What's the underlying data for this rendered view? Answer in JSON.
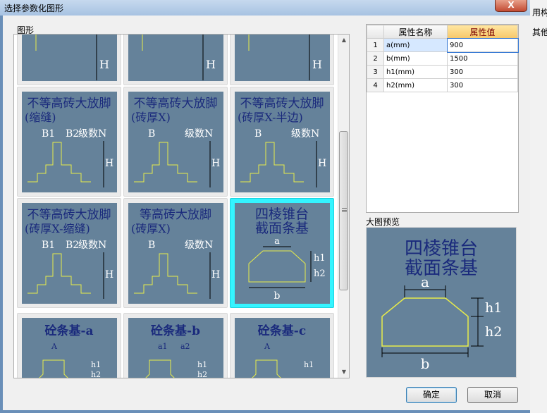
{
  "window": {
    "title": "选择参数化图形",
    "close_label": "X"
  },
  "background_window": {
    "snippets": [
      "用构",
      "其他"
    ]
  },
  "gallery": {
    "label": "图形",
    "items": [
      {
        "line1": "",
        "line2": "",
        "dim_a": "",
        "dim_b": "",
        "levels": "",
        "height": "H"
      },
      {
        "line1": "",
        "line2": "",
        "dim_a": "",
        "dim_b": "",
        "levels": "",
        "height": "H"
      },
      {
        "line1": "",
        "line2": "",
        "dim_a": "",
        "dim_b": "",
        "levels": "",
        "height": "H"
      },
      {
        "line1": "不等高砖大放脚",
        "line2": "(缩缝)",
        "dim_a": "B1",
        "dim_b": "B2",
        "levels": "级数N",
        "height": "H"
      },
      {
        "line1": "不等高砖大放脚",
        "line2": "(砖厚X)",
        "dim_a": "B",
        "dim_b": "",
        "levels": "级数N",
        "height": "H"
      },
      {
        "line1": "不等高砖大放脚",
        "line2": "(砖厚X-半边)",
        "dim_a": "B",
        "dim_b": "",
        "levels": "级数N",
        "height": "H"
      },
      {
        "line1": "不等高砖大放脚",
        "line2": "(砖厚X-缩缝)",
        "dim_a": "B1",
        "dim_b": "B2",
        "levels": "级数N",
        "height": "H"
      },
      {
        "line1": "等高砖大放脚",
        "line2": "(砖厚X)",
        "dim_a": "B",
        "dim_b": "",
        "levels": "级数N",
        "height": "H"
      },
      {
        "line1": "四棱锥台",
        "line2": "截面条基",
        "dim_a": "a",
        "dim_b": "b",
        "levels": "h1",
        "height": "h2"
      },
      {
        "line1": "砼条基-a",
        "line2": "",
        "dim_a": "A",
        "dim_b": "",
        "levels": "h1",
        "height": "h2"
      },
      {
        "line1": "砼条基-b",
        "line2": "",
        "dim_a": "a1",
        "dim_b": "a2",
        "levels": "h1",
        "height": "h2"
      },
      {
        "line1": "砼条基-c",
        "line2": "",
        "dim_a": "A",
        "dim_b": "",
        "levels": "h1",
        "height": ""
      }
    ],
    "selected_index": 8
  },
  "properties": {
    "header": {
      "num": "",
      "name": "属性名称",
      "value": "属性值"
    },
    "rows": [
      {
        "num": "1",
        "name": "a(mm)",
        "value": "900"
      },
      {
        "num": "2",
        "name": "b(mm)",
        "value": "1500"
      },
      {
        "num": "3",
        "name": "h1(mm)",
        "value": "300"
      },
      {
        "num": "4",
        "name": "h2(mm)",
        "value": "300"
      }
    ]
  },
  "preview": {
    "label": "大图预览",
    "line1": "四棱锥台",
    "line2": "截面条基",
    "dim_a": "a",
    "dim_b": "b",
    "dim_h1": "h1",
    "dim_h2": "h2"
  },
  "buttons": {
    "ok": "确定",
    "cancel": "取消"
  },
  "colors": {
    "thumb_bg": "#65829a",
    "selection": "#34f4ff",
    "drawing_line": "#e8ec4a",
    "dark_text": "#1a2a7c"
  }
}
